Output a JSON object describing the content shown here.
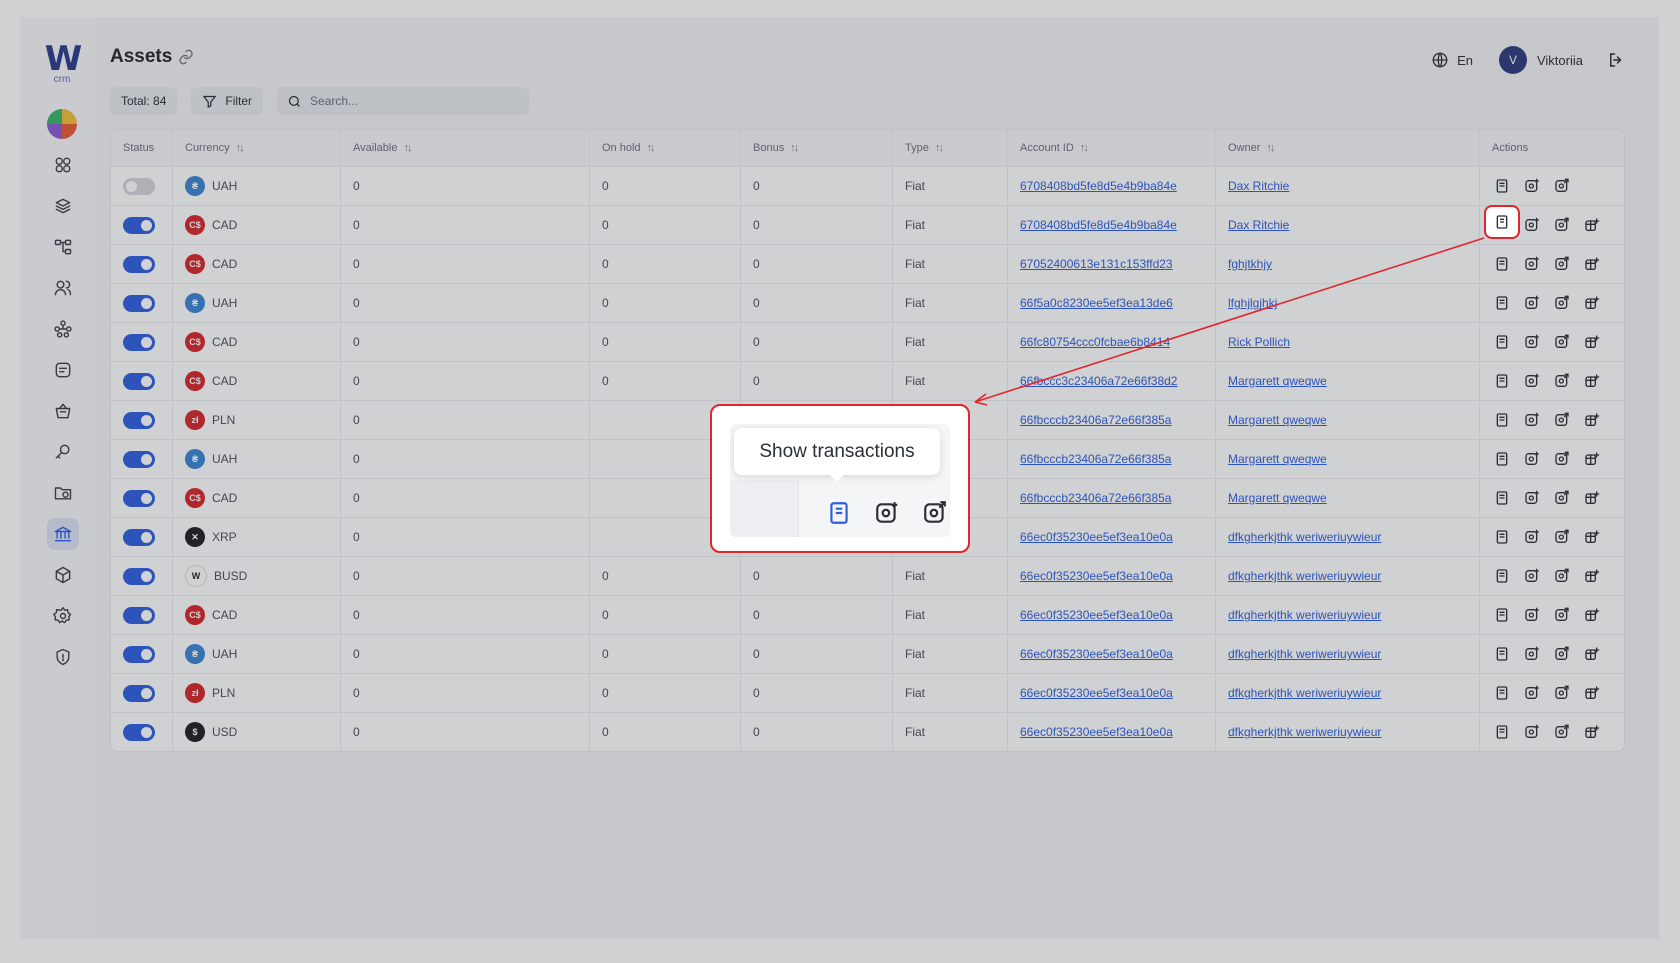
{
  "app": {
    "logo_letter": "W",
    "logo_sub": "crm",
    "title": "Assets",
    "language": "En",
    "user_initial": "V",
    "user_name": "Viktoriia"
  },
  "toolbar": {
    "total_label": "Total: 84",
    "filter_label": "Filter",
    "search_placeholder": "Search..."
  },
  "sidebar": {
    "items": [
      {
        "icon": "dashboard-icon"
      },
      {
        "icon": "layers-icon"
      },
      {
        "icon": "hierarchy-icon"
      },
      {
        "icon": "users-icon"
      },
      {
        "icon": "network-icon"
      },
      {
        "icon": "notes-icon"
      },
      {
        "icon": "basket-icon"
      },
      {
        "icon": "key-icon"
      },
      {
        "icon": "folder-icon"
      },
      {
        "icon": "bank-icon",
        "active": true
      },
      {
        "icon": "cube-icon"
      },
      {
        "icon": "settings-icon"
      },
      {
        "icon": "shield-icon"
      }
    ]
  },
  "table": {
    "columns": [
      "Status",
      "Currency",
      "Available",
      "On hold",
      "Bonus",
      "Type",
      "Account ID",
      "Owner",
      "Actions"
    ],
    "rows": [
      {
        "enabled": false,
        "currency": "UAH",
        "available": "0",
        "on_hold": "0",
        "bonus": "0",
        "type": "Fiat",
        "account_id": "6708408bd5fe8d5e4b9ba84e",
        "owner": "Dax Ritchie",
        "actions": 3
      },
      {
        "enabled": true,
        "currency": "CAD",
        "available": "0",
        "on_hold": "0",
        "bonus": "0",
        "type": "Fiat",
        "account_id": "6708408bd5fe8d5e4b9ba84e",
        "owner": "Dax Ritchie",
        "actions": 4
      },
      {
        "enabled": true,
        "currency": "CAD",
        "available": "0",
        "on_hold": "0",
        "bonus": "0",
        "type": "Fiat",
        "account_id": "67052400613e131c153ffd23",
        "owner": "fghjtkhjy",
        "actions": 4
      },
      {
        "enabled": true,
        "currency": "UAH",
        "available": "0",
        "on_hold": "0",
        "bonus": "0",
        "type": "Fiat",
        "account_id": "66f5a0c8230ee5ef3ea13de6",
        "owner": "lfghjlgjhkj",
        "actions": 4
      },
      {
        "enabled": true,
        "currency": "CAD",
        "available": "0",
        "on_hold": "0",
        "bonus": "0",
        "type": "Fiat",
        "account_id": "66fc80754ccc0fcbae6b8414",
        "owner": "Rick Pollich",
        "actions": 4
      },
      {
        "enabled": true,
        "currency": "CAD",
        "available": "0",
        "on_hold": "0",
        "bonus": "0",
        "type": "Fiat",
        "account_id": "66fbccc3c23406a72e66f38d2",
        "owner": "Margarett qweqwe",
        "actions": 4
      },
      {
        "enabled": true,
        "currency": "PLN",
        "available": "0",
        "on_hold": "",
        "bonus": "",
        "type": "",
        "account_id": "66fbcccb23406a72e66f385a",
        "owner": "Margarett qweqwe",
        "actions": 4
      },
      {
        "enabled": true,
        "currency": "UAH",
        "available": "0",
        "on_hold": "",
        "bonus": "",
        "type": "",
        "account_id": "66fbcccb23406a72e66f385a",
        "owner": "Margarett qweqwe",
        "actions": 4
      },
      {
        "enabled": true,
        "currency": "CAD",
        "available": "0",
        "on_hold": "",
        "bonus": "",
        "type": "",
        "account_id": "66fbcccb23406a72e66f385a",
        "owner": "Margarett qweqwe",
        "actions": 4
      },
      {
        "enabled": true,
        "currency": "XRP",
        "available": "0",
        "on_hold": "",
        "bonus": "",
        "type": "",
        "account_id": "66ec0f35230ee5ef3ea10e0a",
        "owner": "dfkgherkjthk weriweriuywieur",
        "actions": 4
      },
      {
        "enabled": true,
        "currency": "BUSD",
        "available": "0",
        "on_hold": "0",
        "bonus": "0",
        "type": "Fiat",
        "account_id": "66ec0f35230ee5ef3ea10e0a",
        "owner": "dfkgherkjthk weriweriuywieur",
        "actions": 4
      },
      {
        "enabled": true,
        "currency": "CAD",
        "available": "0",
        "on_hold": "0",
        "bonus": "0",
        "type": "Fiat",
        "account_id": "66ec0f35230ee5ef3ea10e0a",
        "owner": "dfkgherkjthk weriweriuywieur",
        "actions": 4
      },
      {
        "enabled": true,
        "currency": "UAH",
        "available": "0",
        "on_hold": "0",
        "bonus": "0",
        "type": "Fiat",
        "account_id": "66ec0f35230ee5ef3ea10e0a",
        "owner": "dfkgherkjthk weriweriuywieur",
        "actions": 4
      },
      {
        "enabled": true,
        "currency": "PLN",
        "available": "0",
        "on_hold": "0",
        "bonus": "0",
        "type": "Fiat",
        "account_id": "66ec0f35230ee5ef3ea10e0a",
        "owner": "dfkgherkjthk weriweriuywieur",
        "actions": 4
      },
      {
        "enabled": true,
        "currency": "USD",
        "available": "0",
        "on_hold": "0",
        "bonus": "0",
        "type": "Fiat",
        "account_id": "66ec0f35230ee5ef3ea10e0a",
        "owner": "dfkgherkjthk weriweriuywieur",
        "actions": 4
      }
    ]
  },
  "currency_icons": {
    "UAH": {
      "glyph": "₴",
      "color": "#3a84d6"
    },
    "CAD": {
      "glyph": "C$",
      "color": "#d8262d"
    },
    "PLN": {
      "glyph": "zł",
      "color": "#d8262d"
    },
    "XRP": {
      "glyph": "✕",
      "color": "#1d1f24"
    },
    "BUSD": {
      "glyph": "W",
      "color": "#ffffff"
    },
    "USD": {
      "glyph": "$",
      "color": "#1d1f24"
    }
  },
  "callout": {
    "tooltip_text": "Show transactions"
  },
  "colors": {
    "accent": "#2f5fe0",
    "highlight": "#e0262c"
  }
}
